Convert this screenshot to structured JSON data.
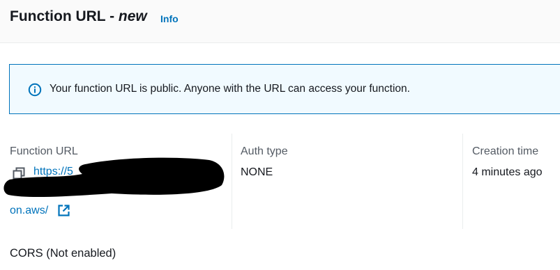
{
  "header": {
    "title_prefix": "Function URL - ",
    "title_version": "new",
    "info_link": "Info"
  },
  "alert": {
    "icon": "info-circle-icon",
    "message": "Your function URL is public. Anyone with the URL can access your function."
  },
  "details": {
    "function_url": {
      "label": "Function URL",
      "value_start": "https://5",
      "value_end": "on.aws/",
      "copy_icon": "copy-icon",
      "external_icon": "external-link-icon"
    },
    "auth_type": {
      "label": "Auth type",
      "value": "NONE"
    },
    "creation_time": {
      "label": "Creation time",
      "value": "4 minutes ago"
    }
  },
  "cors": {
    "label": "CORS (Not enabled)"
  },
  "colors": {
    "link": "#0073bb",
    "alert_background": "#f1faff",
    "alert_border": "#0073bb",
    "label_text": "#545b64",
    "body_text": "#16191f"
  }
}
